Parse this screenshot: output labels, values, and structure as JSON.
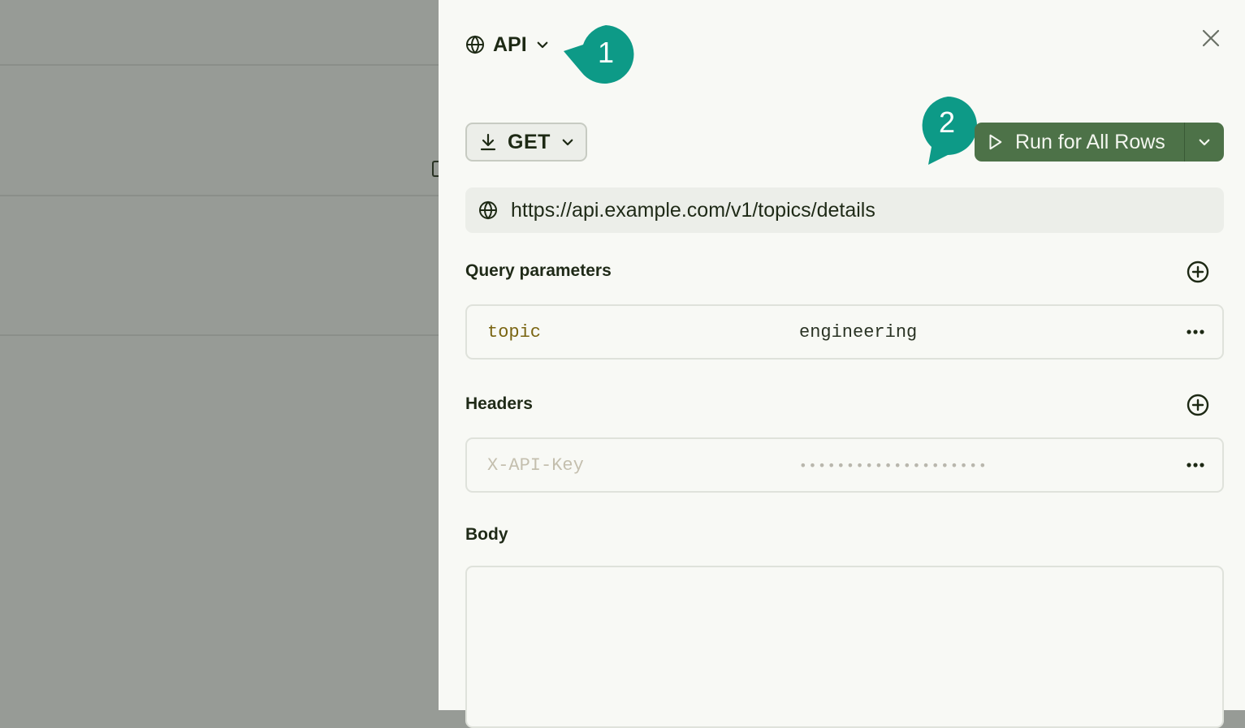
{
  "header": {
    "integration_label": "API",
    "integration_icon": "globe-icon",
    "dropdown_icon": "chevron-down-icon",
    "close_icon": "close-icon"
  },
  "callouts": [
    {
      "number": "1",
      "color": "#0d9a87"
    },
    {
      "number": "2",
      "color": "#0d9a87"
    }
  ],
  "request": {
    "method_label": "GET",
    "method_icon": "download-icon",
    "run_label": "Run for All Rows",
    "run_icon": "play-icon",
    "run_menu_icon": "chevron-down-icon",
    "url_value": "https://api.example.com/v1/topics/details",
    "url_icon": "globe-icon"
  },
  "query_parameters": {
    "title": "Query parameters",
    "add_icon": "plus-circle-icon",
    "rows": [
      {
        "key": "topic",
        "value": "engineering"
      }
    ]
  },
  "headers": {
    "title": "Headers",
    "add_icon": "plus-circle-icon",
    "rows": [
      {
        "key": "X-API-Key",
        "value": "••••••••••••••••••••"
      }
    ]
  },
  "body": {
    "title": "Body",
    "value": ""
  },
  "colors": {
    "accent_green": "#4d7248",
    "callout_teal": "#0d9a87",
    "panel_bg": "#f8f9f5",
    "overlay_bg": "#979b96"
  }
}
